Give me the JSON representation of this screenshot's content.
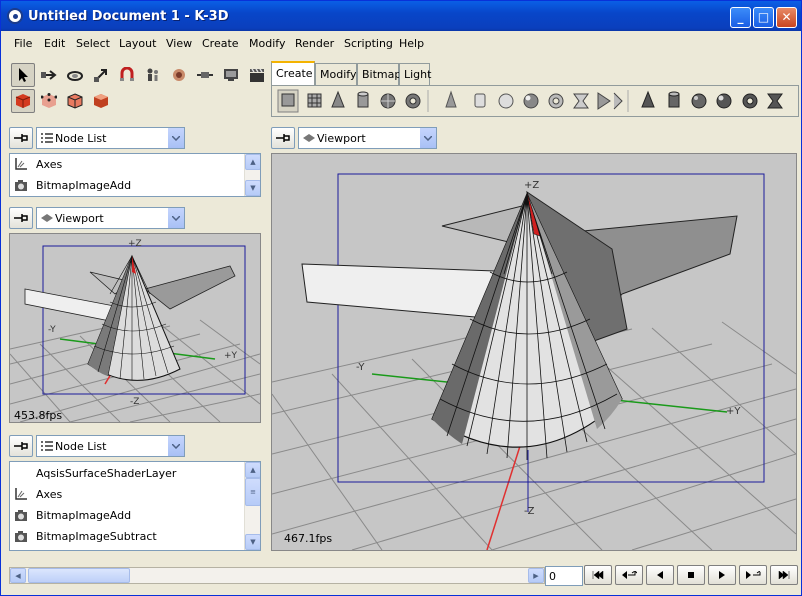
{
  "window": {
    "title": "Untitled Document 1 - K-3D"
  },
  "menu": [
    "File",
    "Edit",
    "Select",
    "Layout",
    "View",
    "Create",
    "Modify",
    "Render",
    "Scripting",
    "Help"
  ],
  "tabs": [
    "Create",
    "Modify",
    "Bitmap",
    "Light"
  ],
  "active_tab": "Create",
  "panel_top": {
    "combo": "Node List",
    "items": [
      "Axes",
      "BitmapImageAdd"
    ]
  },
  "panel_mid": {
    "combo": "Viewport",
    "fps": "453.8fps",
    "axis_z": "+Z",
    "axis_ny": "-Y",
    "axis_py": "+Y",
    "axis_nz": "-Z"
  },
  "panel_bottom": {
    "combo": "Node List",
    "items": [
      "AqsisSurfaceShaderLayer",
      "Axes",
      "BitmapImageAdd",
      "BitmapImageSubtract"
    ]
  },
  "main_viewport": {
    "combo": "Viewport",
    "fps": "467.1fps",
    "axis_z": "+Z",
    "axis_ny": "-Y",
    "axis_py": "+Y",
    "axis_nz": "-Z"
  },
  "timeline": {
    "frame": "0"
  },
  "colors": {
    "titlebar": "#0a4fd6",
    "viewport_bg": "#c6c6c6",
    "selection": "#1a1a9a",
    "axis_x": "#e03030",
    "axis_y": "#1a9a1a"
  }
}
